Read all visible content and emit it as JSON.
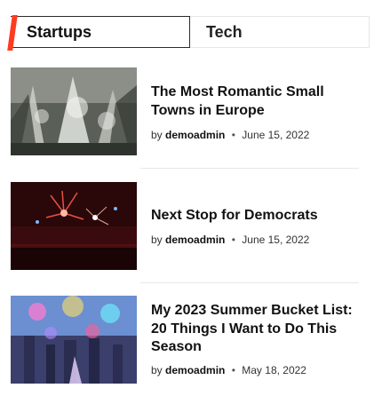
{
  "tabs": {
    "active_label": "Startups",
    "inactive_label": "Tech"
  },
  "posts": [
    {
      "title": "The Most Romantic Small Towns in Europe",
      "by": "by",
      "author": "demoadmin",
      "separator": "•",
      "date": "June 15, 2022"
    },
    {
      "title": "Next Stop for Democrats",
      "by": "by",
      "author": "demoadmin",
      "separator": "•",
      "date": "June 15, 2022"
    },
    {
      "title": "My 2023 Summer Bucket List: 20 Things I Want to Do This Season",
      "by": "by",
      "author": "demoadmin",
      "separator": "•",
      "date": "May 18, 2022"
    }
  ],
  "colors": {
    "accent": "#ff3b1f"
  }
}
